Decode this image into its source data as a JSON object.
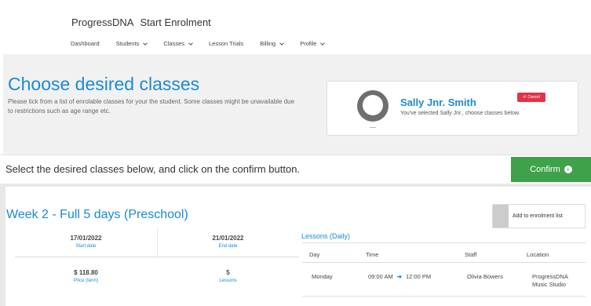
{
  "header": {
    "brand": "ProgressDNA",
    "page": "Start Enrolment",
    "nav": [
      {
        "label": "Dashboard",
        "dropdown": false
      },
      {
        "label": "Students",
        "dropdown": true
      },
      {
        "label": "Classes",
        "dropdown": true
      },
      {
        "label": "Lesson Trials",
        "dropdown": false
      },
      {
        "label": "Billing",
        "dropdown": true
      },
      {
        "label": "Profile",
        "dropdown": true
      }
    ]
  },
  "hero": {
    "title": "Choose desired classes",
    "description": "Please tick from a list of enrolable classes for your the student. Some classes might be unavailable due to restrictions such as age range etc."
  },
  "student": {
    "name": "Sally Jnr. Smith",
    "subtitle": "You've selected Sally Jnr., choose classes below.",
    "cancel_label": "Cancel",
    "cancel_icon": "undo-icon"
  },
  "instruction": "Select the desired classes below, and click on the confirm button.",
  "confirm_label": "Confirm",
  "confirm_icon": "arrow-right-circle-icon",
  "class": {
    "title": "Week 2 - Full 5 days (Preschool)",
    "add_label": "Add to enrolment list",
    "start_date": "17/01/2022",
    "start_date_label": "Start date",
    "end_date": "21/01/2022",
    "end_date_label": "End date",
    "price": "$ 118.80",
    "price_label": "Price (term)",
    "lessons": "5",
    "lessons_label": "Lessons",
    "lessons_title": "Lessons (Daily)",
    "lesson_columns": [
      "Day",
      "Time",
      "Staff",
      "Location"
    ],
    "lesson_rows": [
      {
        "day": "Monday",
        "start": "09:00 AM",
        "end": "12:00 PM",
        "staff": "Olivia Bowers",
        "location_line1": "ProgressDNA",
        "location_line2": "Music Studio"
      }
    ]
  },
  "colors": {
    "accent": "#1a8ad5",
    "confirm": "#3fa24a",
    "cancel": "#e0344a"
  }
}
